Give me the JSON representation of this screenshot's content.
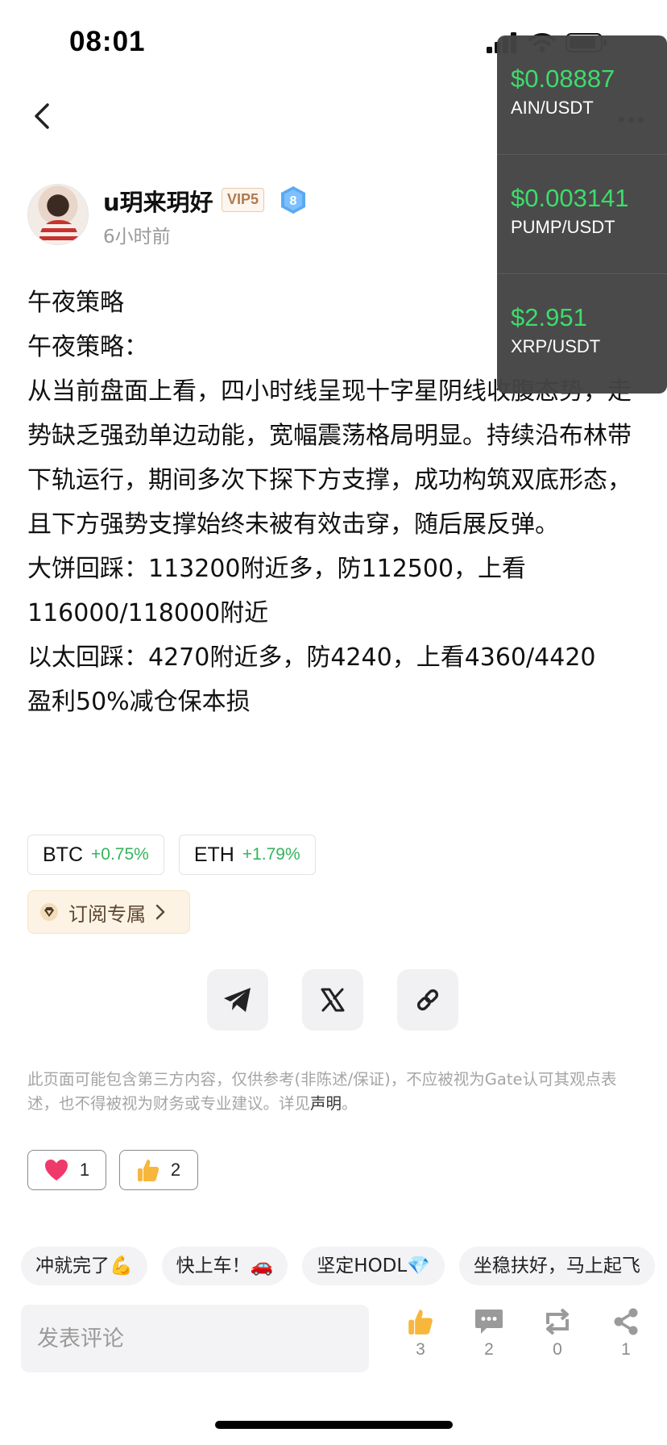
{
  "status_bar": {
    "time": "08:01"
  },
  "author": {
    "name": "u玥来玥好",
    "vip": "VIP5",
    "level": "8",
    "time_ago": "6小时前"
  },
  "post": {
    "lines": [
      "午夜策略",
      "午夜策略：",
      "从当前盘面上看，四小时线呈现十字星阴线收腹态势，走势缺乏强劲单边动能，宽幅震荡格局明显。持续沿布林带下轨运行，期间多次下探下方支撑，成功构筑双底形态，且下方强势支撑始终未被有效击穿，随后展反弹。",
      "大饼回踩：113200附近多，防112500，上看116000/118000附近",
      "以太回踩：4270附近多，防4240，上看4360/4420",
      "盈利50%减仓保本损"
    ]
  },
  "tickers": [
    {
      "symbol": "BTC",
      "change": "+0.75%"
    },
    {
      "symbol": "ETH",
      "change": "+1.79%"
    }
  ],
  "subscribe": {
    "label": "订阅专属"
  },
  "share": {
    "items": [
      "telegram-icon",
      "x-icon",
      "link-icon"
    ]
  },
  "disclaimer": {
    "text": "此页面可能包含第三方内容，仅供参考(非陈述/保证)，不应被视为Gate认可其观点表述，也不得被视为财务或专业建议。详见",
    "link": "声明",
    "end": "。"
  },
  "reactions": [
    {
      "icon": "heart-icon",
      "count": "1"
    },
    {
      "icon": "thumbs-up-icon",
      "count": "2"
    }
  ],
  "quick_comments": [
    "冲就完了💪",
    "快上车！🚗",
    "坚定HODL💎",
    "坐稳扶好，马上起飞"
  ],
  "bottom_bar": {
    "comment_placeholder": "发表评论",
    "like_count": "3",
    "comment_count": "2",
    "repost_count": "0",
    "share_count": "1"
  },
  "price_overlay": [
    {
      "price": "$0.08887",
      "pair": "AIN/USDT"
    },
    {
      "price": "$0.003141",
      "pair": "PUMP/USDT"
    },
    {
      "price": "$2.951",
      "pair": "XRP/USDT"
    }
  ],
  "colors": {
    "positive": "#36b35d",
    "overlay_price": "#3ddc6b",
    "overlay_bg": "#444444"
  }
}
